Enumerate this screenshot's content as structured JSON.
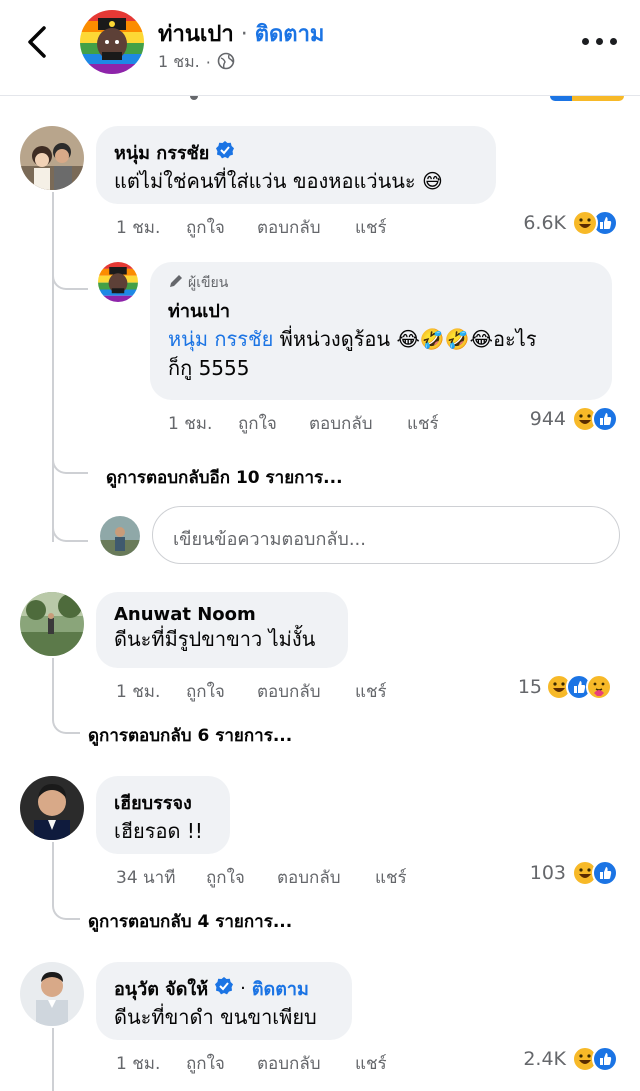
{
  "header": {
    "name": "ท่านเปา",
    "separator": " · ",
    "follow_label": "ติดตาม",
    "time": "1 ชม.",
    "dot": "·"
  },
  "comments": [
    {
      "author": "หนุ่ม กรรชัย",
      "verified": true,
      "text": "แต่ไม่ใช่คนที่ใส่แว่น ของหอแว่นนะ 😅",
      "time": "1 ชม.",
      "like": "ถูกใจ",
      "reply": "ตอบกลับ",
      "share": "แชร์",
      "reaction_count": "6.6K",
      "reactions": [
        "haha",
        "like"
      ],
      "reply_item": {
        "badge": "ผู้เขียน",
        "author": "ท่านเปา",
        "mention": "หนุ่ม กรรชัย",
        "text_line1": " พี่หน่วงดูร้อน 😂🤣🤣😂อะไร",
        "text_line2": "ก็กู 5555",
        "time": "1 ชม.",
        "like": "ถูกใจ",
        "reply": "ตอบกลับ",
        "share": "แชร์",
        "reaction_count": "944",
        "reactions": [
          "haha",
          "like"
        ]
      },
      "more_replies": "ดูการตอบกลับอีก 10 รายการ...",
      "reply_placeholder": "เขียนข้อความตอบกลับ..."
    },
    {
      "author": "Anuwat Noom",
      "text": "ดีนะที่มีรูปขาขาว ไม่งั้น",
      "time": "1 ชม.",
      "like": "ถูกใจ",
      "reply": "ตอบกลับ",
      "share": "แชร์",
      "reaction_count": "15",
      "reactions": [
        "haha",
        "like",
        "care"
      ],
      "more_replies": "ดูการตอบกลับ 6 รายการ..."
    },
    {
      "author": "เฮียบรรจง",
      "text": "เฮียรอด !!",
      "time": "34 นาที",
      "like": "ถูกใจ",
      "reply": "ตอบกลับ",
      "share": "แชร์",
      "reaction_count": "103",
      "reactions": [
        "haha",
        "like"
      ],
      "more_replies": "ดูการตอบกลับ 4 รายการ..."
    },
    {
      "author": "อนุวัต จัดให้",
      "verified": true,
      "follow_label": "ติดตาม",
      "text": "ดีนะที่ขาดำ ขนขาเพียบ",
      "time": "1 ชม.",
      "like": "ถูกใจ",
      "reply": "ตอบกลับ",
      "share": "แชร์",
      "reaction_count": "2.4K",
      "reactions": [
        "haha",
        "like"
      ]
    }
  ],
  "colors": {
    "link_blue": "#1b74e4",
    "bubble_bg": "#f0f2f5",
    "secondary_text": "#65676b",
    "thread_line": "#ced0d4"
  },
  "icons": [
    "back-arrow-icon",
    "public-globe-icon",
    "more-options-icon",
    "verified-badge-icon",
    "author-pen-icon",
    "haha-reaction-icon",
    "like-reaction-icon",
    "care-reaction-icon"
  ]
}
